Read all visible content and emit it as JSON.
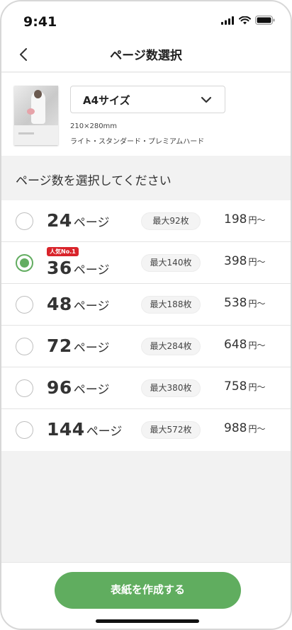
{
  "status": {
    "time": "9:41"
  },
  "header": {
    "title": "ページ数選択"
  },
  "product": {
    "size_label": "A4サイズ",
    "dimensions": "210×280mm",
    "types": "ライト・スタンダード・プレミアムハード"
  },
  "section": {
    "heading": "ページ数を選択してください"
  },
  "options": [
    {
      "pages": "24",
      "unit": "ページ",
      "max": "最大92枚",
      "price": "198",
      "price_unit": "円〜",
      "selected": false,
      "badge": ""
    },
    {
      "pages": "36",
      "unit": "ページ",
      "max": "最大140枚",
      "price": "398",
      "price_unit": "円〜",
      "selected": true,
      "badge": "人気No.1"
    },
    {
      "pages": "48",
      "unit": "ページ",
      "max": "最大188枚",
      "price": "538",
      "price_unit": "円〜",
      "selected": false,
      "badge": ""
    },
    {
      "pages": "72",
      "unit": "ページ",
      "max": "最大284枚",
      "price": "648",
      "price_unit": "円〜",
      "selected": false,
      "badge": ""
    },
    {
      "pages": "96",
      "unit": "ページ",
      "max": "最大380枚",
      "price": "758",
      "price_unit": "円〜",
      "selected": false,
      "badge": ""
    },
    {
      "pages": "144",
      "unit": "ページ",
      "max": "最大572枚",
      "price": "988",
      "price_unit": "円〜",
      "selected": false,
      "badge": ""
    }
  ],
  "cta": {
    "label": "表紙を作成する"
  },
  "colors": {
    "accent": "#60ad5f",
    "badge": "#d9242b"
  },
  "icons": {
    "back": "chevron-left-icon",
    "dropdown": "chevron-down-icon",
    "signal": "signal-icon",
    "wifi": "wifi-icon",
    "battery": "battery-icon"
  }
}
